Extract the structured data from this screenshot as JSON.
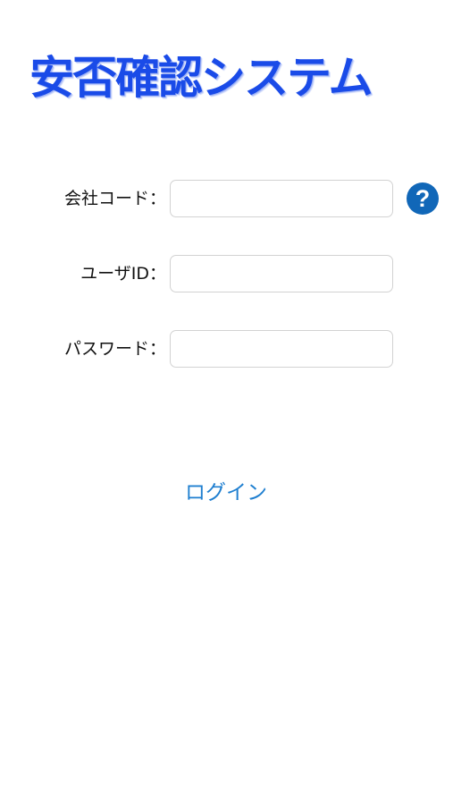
{
  "app": {
    "title": "安否確認システム",
    "brand_color": "#1a4be8"
  },
  "form": {
    "company_code": {
      "label": "会社コード：",
      "value": "",
      "placeholder": ""
    },
    "user_id": {
      "label": "ユーザID：",
      "value": "",
      "placeholder": ""
    },
    "password": {
      "label": "パスワード：",
      "value": "",
      "placeholder": ""
    },
    "help": {
      "icon": "question-circle-icon",
      "glyph": "?",
      "color": "#1167b8"
    }
  },
  "login": {
    "label": "ログイン",
    "color": "#1f7fd0"
  }
}
